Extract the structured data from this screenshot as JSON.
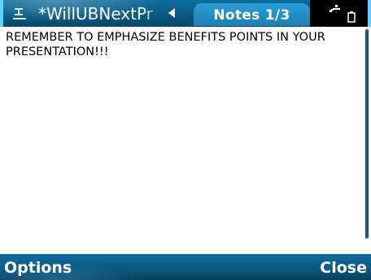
{
  "title_bar": {
    "document_title": "*WillUBNextPr",
    "tab_label": "Notes 1/3",
    "app_icon": "notes-app-icon",
    "left_arrow_icon": "triangle-left-icon",
    "connection_icon": "connection-icon",
    "battery_icon": "battery-icon"
  },
  "note": {
    "text": "REMEMBER TO EMPHASIZE BENEFITS POINTS IN YOUR PRESENTATION!!!"
  },
  "softkeys": {
    "left_label": "Options",
    "right_label": "Close"
  },
  "colors": {
    "bar_blue": "#0a5a82",
    "tab_blue": "#1b7fb3",
    "accent_cyan": "#5fd0ff",
    "scrollbar": "#0b3f63",
    "text": "#000000"
  }
}
